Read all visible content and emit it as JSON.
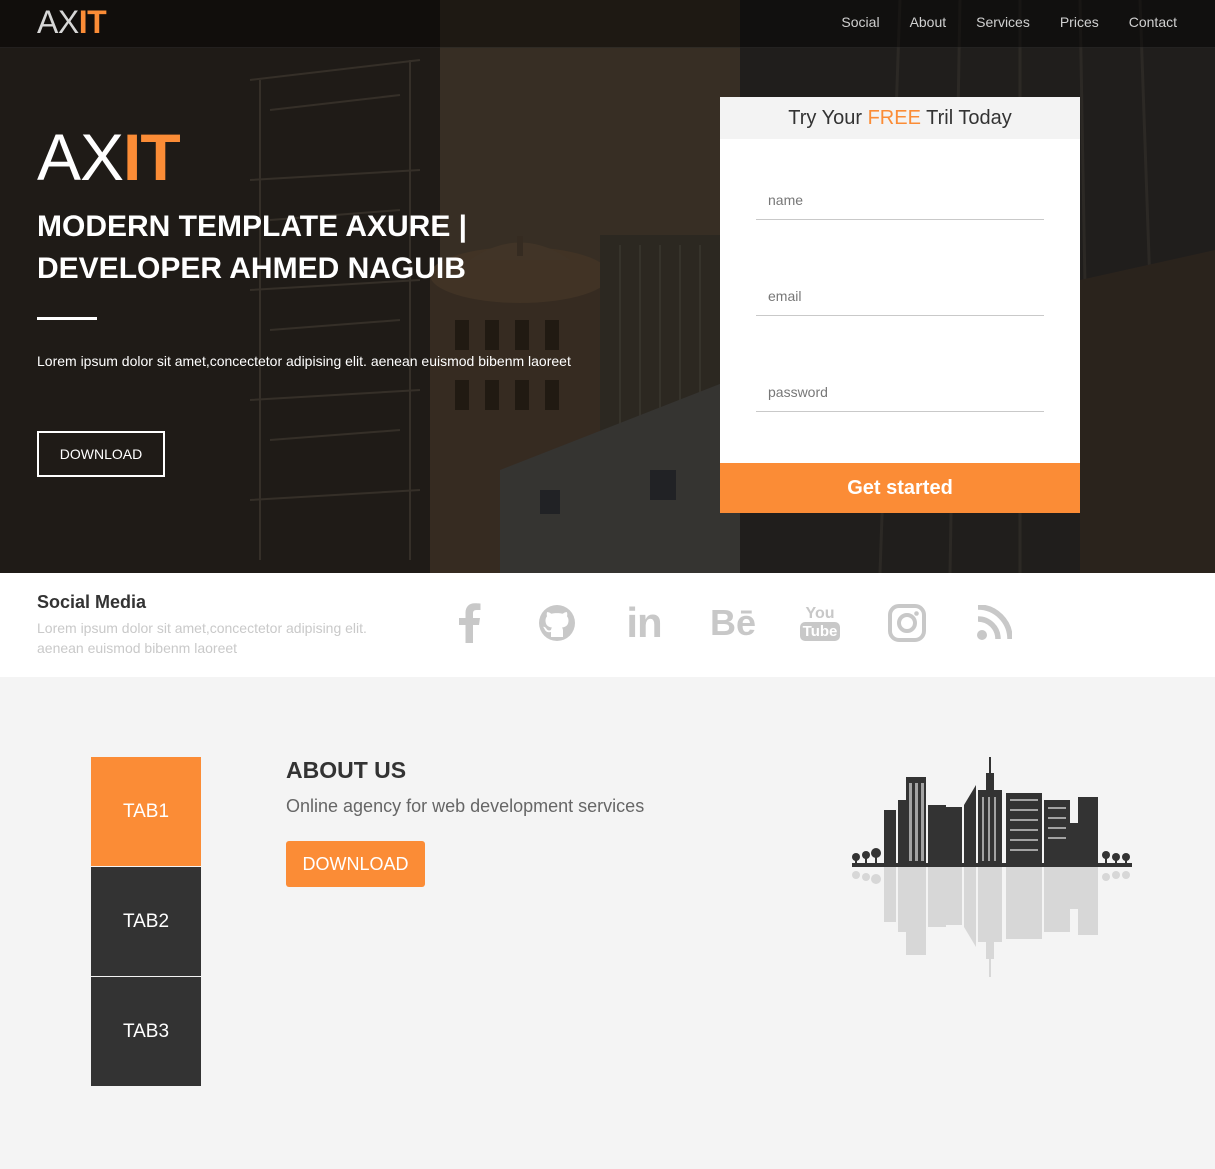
{
  "brand": {
    "prefix": "AX",
    "suffix": "IT"
  },
  "nav": {
    "items": [
      "Social",
      "About",
      "Services",
      "Prices",
      "Contact"
    ]
  },
  "hero": {
    "title": "MODERN TEMPLATE AXURE | DEVELOPER AHMED NAGUIB",
    "text": "Lorem ipsum dolor sit amet,concectetor adipising elit. aenean euismod bibenm laoreet",
    "button": "DOWNLOAD"
  },
  "signup": {
    "title_before": "Try Your ",
    "title_highlight": "FREE",
    "title_after": " Tril Today",
    "name_placeholder": "name",
    "email_placeholder": "email",
    "password_placeholder": "password",
    "button": "Get started"
  },
  "social": {
    "title": "Social Media",
    "text": "Lorem ipsum dolor sit amet,concectetor adipising elit. aenean euismod bibenm laoreet",
    "icons": [
      "facebook-icon",
      "github-icon",
      "linkedin-icon",
      "behance-icon",
      "youtube-icon",
      "instagram-icon",
      "rss-icon"
    ],
    "youtube_label_top": "You",
    "youtube_label_bottom": "Tube",
    "behance_label": "Bē",
    "linkedin_label": "in"
  },
  "tabs": [
    "TAB1",
    "TAB2",
    "TAB3"
  ],
  "about": {
    "title": "ABOUT US",
    "subtitle": "Online agency for web development services",
    "button": "DOWNLOAD"
  },
  "colors": {
    "accent": "#fb8c36",
    "dark": "#333333",
    "icon": "#c8c8c8"
  }
}
